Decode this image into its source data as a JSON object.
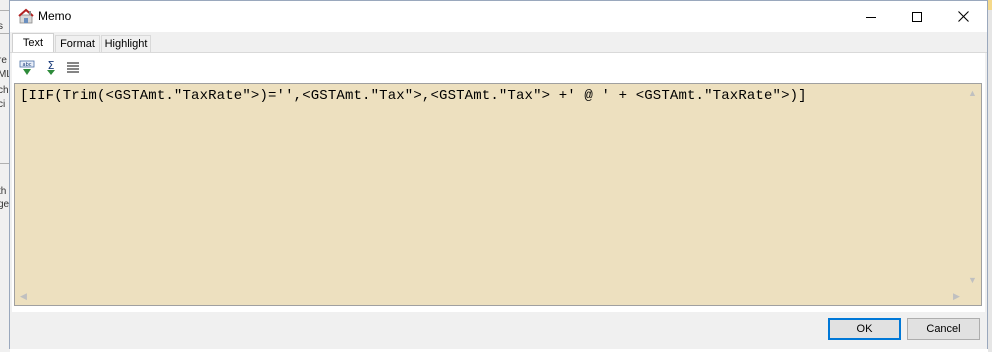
{
  "window": {
    "title": "Memo",
    "controls": [
      "minimize-icon",
      "maximize-icon",
      "close-icon"
    ]
  },
  "tabs": [
    {
      "label": "Text",
      "active": true
    },
    {
      "label": "Format",
      "active": false
    },
    {
      "label": "Highlight",
      "active": false
    }
  ],
  "toolbar": {
    "items": [
      "insert-field-icon",
      "sum-icon",
      "align-text-icon"
    ]
  },
  "editor": {
    "text": "[IIF(Trim(<GSTAmt.\"TaxRate\">)='',<GSTAmt.\"Tax\">,<GSTAmt.\"Tax\"> +' @ ' + <GSTAmt.\"TaxRate\">)]",
    "background": "#ede0bf"
  },
  "buttons": {
    "ok": "OK",
    "cancel": "Cancel"
  },
  "colors": {
    "focus_border": "#0078d7",
    "toolbar_icon_green": "#2e8b3a"
  },
  "background_app": {
    "fragments": [
      "re",
      "ML",
      "ch",
      "ci",
      "th",
      "ge"
    ]
  }
}
